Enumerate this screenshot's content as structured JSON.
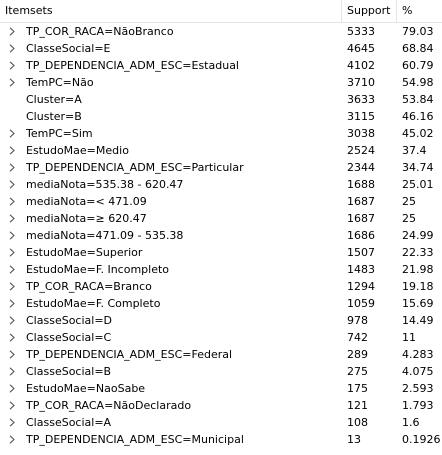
{
  "columns": {
    "itemsets": "Itemsets",
    "support": "Support",
    "percent": "%"
  },
  "rows": [
    {
      "label": "TP_COR_RACA=NãoBranco",
      "support": "5333",
      "percent": "79.03",
      "expandable": true
    },
    {
      "label": "ClasseSocial=E",
      "support": "4645",
      "percent": "68.84",
      "expandable": true
    },
    {
      "label": "TP_DEPENDENCIA_ADM_ESC=Estadual",
      "support": "4102",
      "percent": "60.79",
      "expandable": true
    },
    {
      "label": "TemPC=Não",
      "support": "3710",
      "percent": "54.98",
      "expandable": true
    },
    {
      "label": "Cluster=A",
      "support": "3633",
      "percent": "53.84",
      "expandable": false
    },
    {
      "label": "Cluster=B",
      "support": "3115",
      "percent": "46.16",
      "expandable": false
    },
    {
      "label": "TemPC=Sim",
      "support": "3038",
      "percent": "45.02",
      "expandable": true
    },
    {
      "label": "EstudoMae=Medio",
      "support": "2524",
      "percent": "37.4",
      "expandable": true
    },
    {
      "label": "TP_DEPENDENCIA_ADM_ESC=Particular",
      "support": "2344",
      "percent": "34.74",
      "expandable": true
    },
    {
      "label": "mediaNota=535.38 - 620.47",
      "support": "1688",
      "percent": "25.01",
      "expandable": true
    },
    {
      "label": "mediaNota=< 471.09",
      "support": "1687",
      "percent": "25",
      "expandable": true
    },
    {
      "label": "mediaNota=≥ 620.47",
      "support": "1687",
      "percent": "25",
      "expandable": true
    },
    {
      "label": "mediaNota=471.09 - 535.38",
      "support": "1686",
      "percent": "24.99",
      "expandable": true
    },
    {
      "label": "EstudoMae=Superior",
      "support": "1507",
      "percent": "22.33",
      "expandable": true
    },
    {
      "label": "EstudoMae=F. Incompleto",
      "support": "1483",
      "percent": "21.98",
      "expandable": true
    },
    {
      "label": "TP_COR_RACA=Branco",
      "support": "1294",
      "percent": "19.18",
      "expandable": true
    },
    {
      "label": "EstudoMae=F. Completo",
      "support": "1059",
      "percent": "15.69",
      "expandable": true
    },
    {
      "label": "ClasseSocial=D",
      "support": "978",
      "percent": "14.49",
      "expandable": true
    },
    {
      "label": "ClasseSocial=C",
      "support": "742",
      "percent": "11",
      "expandable": true
    },
    {
      "label": "TP_DEPENDENCIA_ADM_ESC=Federal",
      "support": "289",
      "percent": "4.283",
      "expandable": true
    },
    {
      "label": "ClasseSocial=B",
      "support": "275",
      "percent": "4.075",
      "expandable": true
    },
    {
      "label": "EstudoMae=NaoSabe",
      "support": "175",
      "percent": "2.593",
      "expandable": true
    },
    {
      "label": "TP_COR_RACA=NãoDeclarado",
      "support": "121",
      "percent": "1.793",
      "expandable": true
    },
    {
      "label": "ClasseSocial=A",
      "support": "108",
      "percent": "1.6",
      "expandable": true
    },
    {
      "label": "TP_DEPENDENCIA_ADM_ESC=Municipal",
      "support": "13",
      "percent": "0.1926",
      "expandable": true
    }
  ],
  "icons": {
    "expander": "chevron-right-icon"
  },
  "colors": {
    "grid_line": "#e5e5e5",
    "chevron": "#555555"
  }
}
